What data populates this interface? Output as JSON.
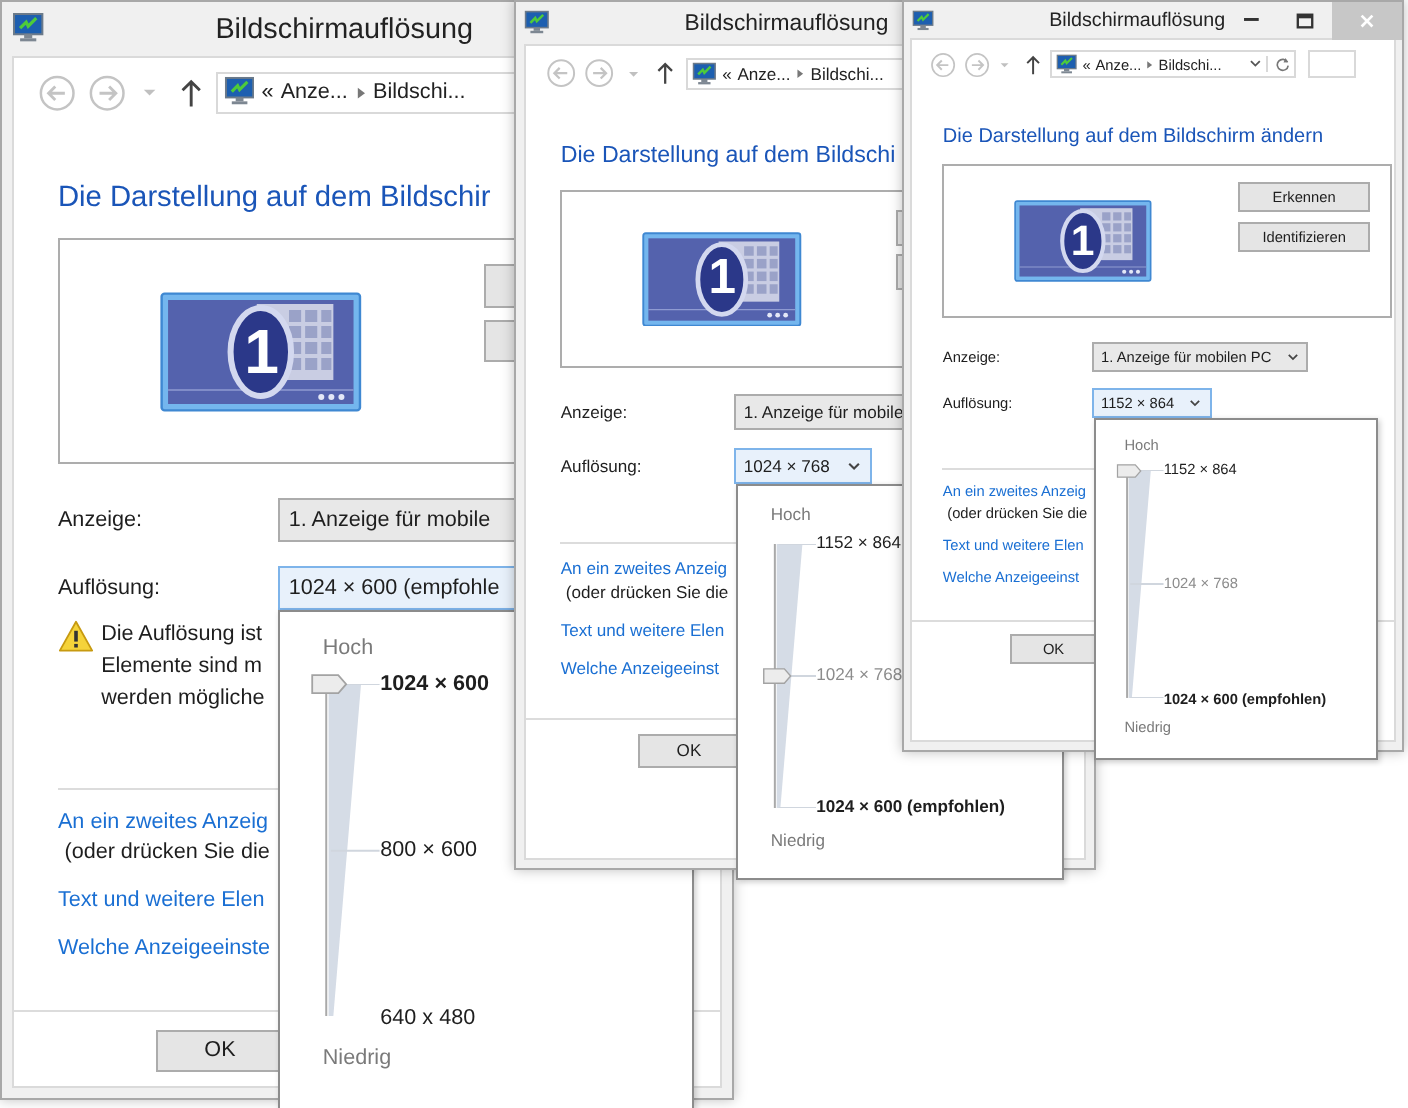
{
  "windows": [
    {
      "title": "Bildschirmauflösung",
      "caption_buttons": false,
      "address_controls": false,
      "breadcrumb_marker": "«",
      "breadcrumb": [
        "Anze...",
        "Bildschi..."
      ],
      "heading": "Die Darstellung auf dem Bildschir",
      "display_number": "1",
      "display_label": "Anzeige:",
      "display_value": "1. Anzeige für mobile",
      "resolution_label": "Auflösung:",
      "resolution_value": "1024 × 600 (empfohle",
      "warning_lines": [
        "Die Auflösung ist",
        "Elemente sind m",
        "werden mögliche"
      ],
      "links": [
        {
          "text": "An ein zweites Anzeig",
          "kind": "link"
        },
        {
          "text": "(oder drücken Sie die",
          "kind": "note"
        },
        {
          "text": "Text und weitere Elen",
          "kind": "link"
        },
        {
          "text": "Welche Anzeigeeinste",
          "kind": "link"
        }
      ],
      "ok_button": "OK",
      "resolution_popup": {
        "high_label": "Hoch",
        "low_label": "Niedrig",
        "level": 1,
        "options": [
          {
            "label": "1024 × 600",
            "bold": true,
            "dimmed": false
          },
          {
            "label": "800 × 600",
            "bold": false,
            "dimmed": false
          },
          {
            "label": "640 x 480",
            "bold": false,
            "dimmed": false
          }
        ]
      }
    },
    {
      "title": "Bildschirmauflösung",
      "caption_buttons": false,
      "address_controls": false,
      "breadcrumb_marker": "«",
      "breadcrumb": [
        "Anze...",
        "Bildschi..."
      ],
      "heading": "Die Darstellung auf dem Bildschi",
      "display_number": "1",
      "display_label": "Anzeige:",
      "display_value": "1. Anzeige für mobile",
      "resolution_label": "Auflösung:",
      "resolution_value": "1024 × 768",
      "links": [
        {
          "text": "An ein zweites Anzeig",
          "kind": "link"
        },
        {
          "text": "(oder drücken Sie die",
          "kind": "note"
        },
        {
          "text": "Text und weitere Elen",
          "kind": "link"
        },
        {
          "text": "Welche Anzeigeeinst",
          "kind": "link"
        }
      ],
      "ok_button": "OK",
      "resolution_popup": {
        "high_label": "Hoch",
        "low_label": "Niedrig",
        "level": 0.5,
        "options": [
          {
            "label": "1152 × 864",
            "bold": false,
            "dimmed": false
          },
          {
            "label": "1024 × 768",
            "bold": false,
            "dimmed": true
          },
          {
            "label": "1024 × 600 (empfohlen)",
            "bold": true,
            "dimmed": false
          }
        ]
      }
    },
    {
      "title": "Bildschirmauflösung",
      "caption_buttons": true,
      "address_controls": true,
      "breadcrumb_marker": "«",
      "breadcrumb": [
        "Anze...",
        "Bildschi..."
      ],
      "heading": "Die Darstellung auf dem Bildschirm ändern",
      "display_number": "1",
      "side_buttons": [
        "Erkennen",
        "Identifizieren"
      ],
      "display_label": "Anzeige:",
      "display_value": "1. Anzeige für mobilen PC",
      "resolution_label": "Auflösung:",
      "resolution_value": "1152 × 864",
      "links": [
        {
          "text": "An ein zweites Anzeig",
          "kind": "link"
        },
        {
          "text": "(oder drücken Sie die",
          "kind": "note"
        },
        {
          "text": "Text und weitere Elen",
          "kind": "link"
        },
        {
          "text": "Welche Anzeigeeinst",
          "kind": "link"
        }
      ],
      "ok_button": "OK",
      "resolution_popup": {
        "high_label": "Hoch",
        "low_label": "Niedrig",
        "level": 1,
        "options": [
          {
            "label": "1152 × 864",
            "bold": false,
            "dimmed": false
          },
          {
            "label": "1024 × 768",
            "bold": false,
            "dimmed": true
          },
          {
            "label": "1024 × 600 (empfohlen)",
            "bold": true,
            "dimmed": false
          }
        ]
      }
    }
  ]
}
